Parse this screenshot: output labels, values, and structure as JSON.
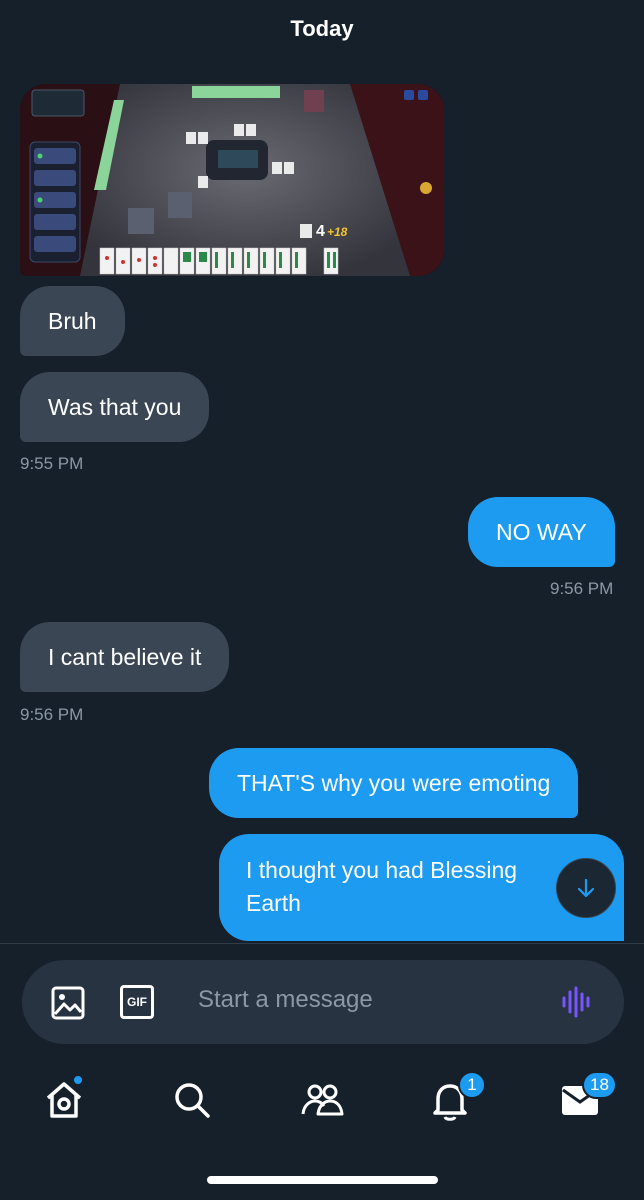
{
  "header": {
    "date": "Today"
  },
  "messages": [
    {
      "from": "them",
      "type": "image",
      "overlay_score": "4",
      "overlay_plus": "+18"
    },
    {
      "from": "them",
      "text": "Bruh"
    },
    {
      "from": "them",
      "text": "Was that you",
      "time": "9:55 PM"
    },
    {
      "from": "me",
      "text": "NO WAY",
      "time": "9:56 PM"
    },
    {
      "from": "them",
      "text": "I cant believe it",
      "time": "9:56 PM"
    },
    {
      "from": "me",
      "text": "THAT'S why you were emoting"
    },
    {
      "from": "me",
      "text_line1": "I thought you had Blessing",
      "text_line2": "Earth"
    }
  ],
  "composer": {
    "placeholder": "Start a message",
    "gif_label": "GIF",
    "icons": [
      "image-icon",
      "gif-icon",
      "voice-wave-icon"
    ],
    "voice_color": "#7856ff"
  },
  "nav": {
    "items": [
      "home",
      "search",
      "communities",
      "notifications",
      "messages"
    ],
    "notifications_badge": "1",
    "messages_badge": "18"
  },
  "colors": {
    "background": "#15202b",
    "accent": "#1d9bf0",
    "incoming_bubble": "#3a4654",
    "timestamp": "#8b98a5"
  }
}
